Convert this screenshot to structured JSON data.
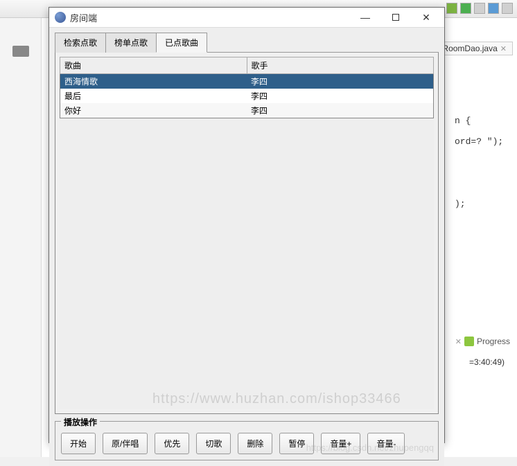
{
  "background": {
    "editor_tab": "*RoomDao.java",
    "code_line1": "n {",
    "code_line2": "ord=?   \");",
    "code_line3": ");",
    "progress_label": "Progress",
    "time_label": "=3:40:49)"
  },
  "watermark": {
    "main": "https://www.huzhan.com/ishop33466",
    "sub": "https://blog.csdn.net/zhupengqq"
  },
  "dialog": {
    "title": "房间端",
    "tabs": [
      {
        "label": "检索点歌",
        "active": false
      },
      {
        "label": "榜单点歌",
        "active": false
      },
      {
        "label": "已点歌曲",
        "active": true
      }
    ],
    "table": {
      "columns": [
        "歌曲",
        "歌手"
      ],
      "rows": [
        {
          "song": "西海情歌",
          "artist": "李四",
          "selected": true
        },
        {
          "song": "最后",
          "artist": "李四",
          "selected": false
        },
        {
          "song": "你好",
          "artist": "李四",
          "selected": false
        }
      ]
    },
    "play_section": {
      "title": "播放操作",
      "buttons": [
        "开始",
        "原/伴唱",
        "优先",
        "切歌",
        "删除",
        "暂停",
        "音量+",
        "音量-"
      ]
    }
  }
}
